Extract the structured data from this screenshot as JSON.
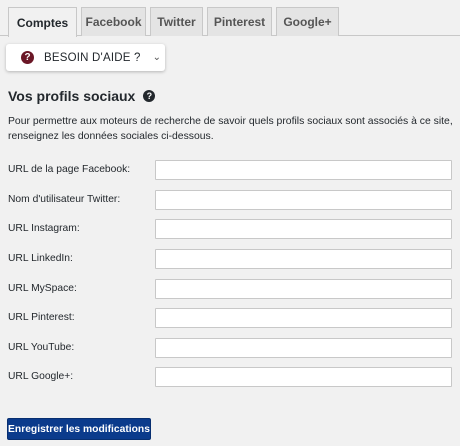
{
  "tabs": [
    {
      "label": "Comptes",
      "active": true
    },
    {
      "label": "Facebook",
      "active": false
    },
    {
      "label": "Twitter",
      "active": false
    },
    {
      "label": "Pinterest",
      "active": false
    },
    {
      "label": "Google+",
      "active": false
    }
  ],
  "help": {
    "icon": "?",
    "label": "BESOIN D'AIDE ?",
    "chevron": "⌄"
  },
  "section": {
    "title": "Vos profils sociaux",
    "help_icon": "?",
    "description": "Pour permettre aux moteurs de recherche de savoir quels profils sociaux sont associés à ce site, renseignez les données sociales ci-dessous."
  },
  "fields": [
    {
      "label": "URL de la page Facebook:",
      "value": "",
      "placeholder": ""
    },
    {
      "label": "Nom d'utilisateur Twitter:",
      "value": "",
      "placeholder": ""
    },
    {
      "label": "URL Instagram:",
      "value": "",
      "placeholder": ""
    },
    {
      "label": "URL LinkedIn:",
      "value": "",
      "placeholder": ""
    },
    {
      "label": "URL MySpace:",
      "value": "",
      "placeholder": ""
    },
    {
      "label": "URL Pinterest:",
      "value": "",
      "placeholder": ""
    },
    {
      "label": "URL YouTube:",
      "value": "",
      "placeholder": ""
    },
    {
      "label": "URL Google+:",
      "value": "",
      "placeholder": ""
    }
  ],
  "save_button": "Enregistrer les modifications",
  "colors": {
    "accent": "#0b3b8c",
    "help_icon": "#6b1726",
    "background": "#f1f1f1"
  }
}
